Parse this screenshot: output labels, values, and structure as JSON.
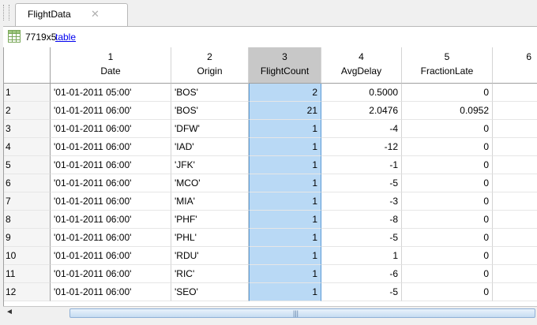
{
  "tab": {
    "label": "FlightData",
    "close_glyph": "✕"
  },
  "info": {
    "size": "7719x5",
    "link": "table"
  },
  "columns": [
    {
      "num": "1",
      "name": "Date"
    },
    {
      "num": "2",
      "name": "Origin"
    },
    {
      "num": "3",
      "name": "FlightCount"
    },
    {
      "num": "4",
      "name": "AvgDelay"
    },
    {
      "num": "5",
      "name": "FractionLate"
    },
    {
      "num": "6",
      "name": ""
    }
  ],
  "rows": [
    {
      "idx": "1",
      "date": "'01-01-2011 05:00'",
      "origin": "'BOS'",
      "count": "2",
      "delay": "0.5000",
      "late": "0"
    },
    {
      "idx": "2",
      "date": "'01-01-2011 06:00'",
      "origin": "'BOS'",
      "count": "21",
      "delay": "2.0476",
      "late": "0.0952"
    },
    {
      "idx": "3",
      "date": "'01-01-2011 06:00'",
      "origin": "'DFW'",
      "count": "1",
      "delay": "-4",
      "late": "0"
    },
    {
      "idx": "4",
      "date": "'01-01-2011 06:00'",
      "origin": "'IAD'",
      "count": "1",
      "delay": "-12",
      "late": "0"
    },
    {
      "idx": "5",
      "date": "'01-01-2011 06:00'",
      "origin": "'JFK'",
      "count": "1",
      "delay": "-1",
      "late": "0"
    },
    {
      "idx": "6",
      "date": "'01-01-2011 06:00'",
      "origin": "'MCO'",
      "count": "1",
      "delay": "-5",
      "late": "0"
    },
    {
      "idx": "7",
      "date": "'01-01-2011 06:00'",
      "origin": "'MIA'",
      "count": "1",
      "delay": "-3",
      "late": "0"
    },
    {
      "idx": "8",
      "date": "'01-01-2011 06:00'",
      "origin": "'PHF'",
      "count": "1",
      "delay": "-8",
      "late": "0"
    },
    {
      "idx": "9",
      "date": "'01-01-2011 06:00'",
      "origin": "'PHL'",
      "count": "1",
      "delay": "-5",
      "late": "0"
    },
    {
      "idx": "10",
      "date": "'01-01-2011 06:00'",
      "origin": "'RDU'",
      "count": "1",
      "delay": "1",
      "late": "0"
    },
    {
      "idx": "11",
      "date": "'01-01-2011 06:00'",
      "origin": "'RIC'",
      "count": "1",
      "delay": "-6",
      "late": "0"
    },
    {
      "idx": "12",
      "date": "'01-01-2011 06:00'",
      "origin": "'SEO'",
      "count": "1",
      "delay": "-5",
      "late": "0"
    }
  ],
  "scrollbar": {
    "left_arrow": "◄",
    "grip": "|||"
  },
  "colors": {
    "selection": "#b9d9f5",
    "selected_header": "#c8c8c8",
    "link": "#0000ee"
  }
}
